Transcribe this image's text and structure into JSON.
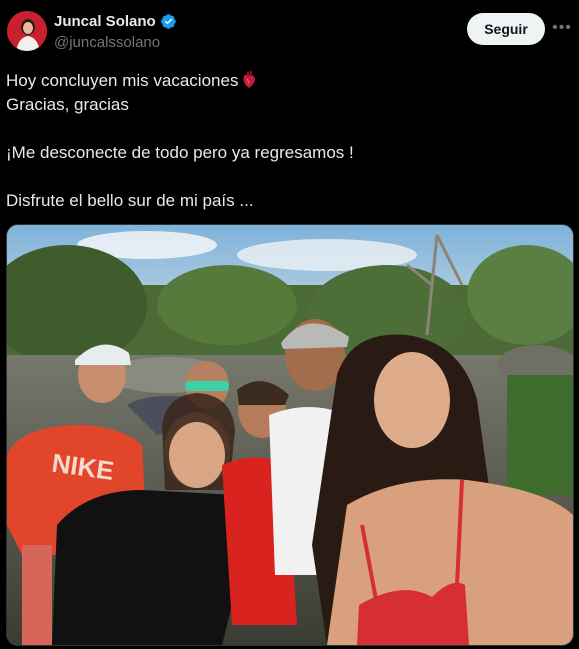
{
  "author": {
    "display_name": "Juncal Solano",
    "handle": "@juncalssolano",
    "verified": true,
    "avatar_icon": "profile-avatar"
  },
  "actions": {
    "follow_label": "Seguir",
    "more_icon": "more-horizontal-icon"
  },
  "tweet": {
    "lines": [
      "Hoy concluyen mis vacaciones",
      "Gracias, gracias",
      "",
      "¡Me desconecte de todo pero ya regresamos !",
      "",
      "Disfrute el bello sur de mi país ..."
    ],
    "emoji": "anatomical-heart-emoji"
  },
  "media": {
    "type": "photo",
    "shirt_text": "NIKE"
  },
  "colors": {
    "background": "#000000",
    "text": "#e7e9ea",
    "secondary_text": "#71767b",
    "verified_blue": "#1d9bf0",
    "follow_bg": "#eff3f4"
  }
}
